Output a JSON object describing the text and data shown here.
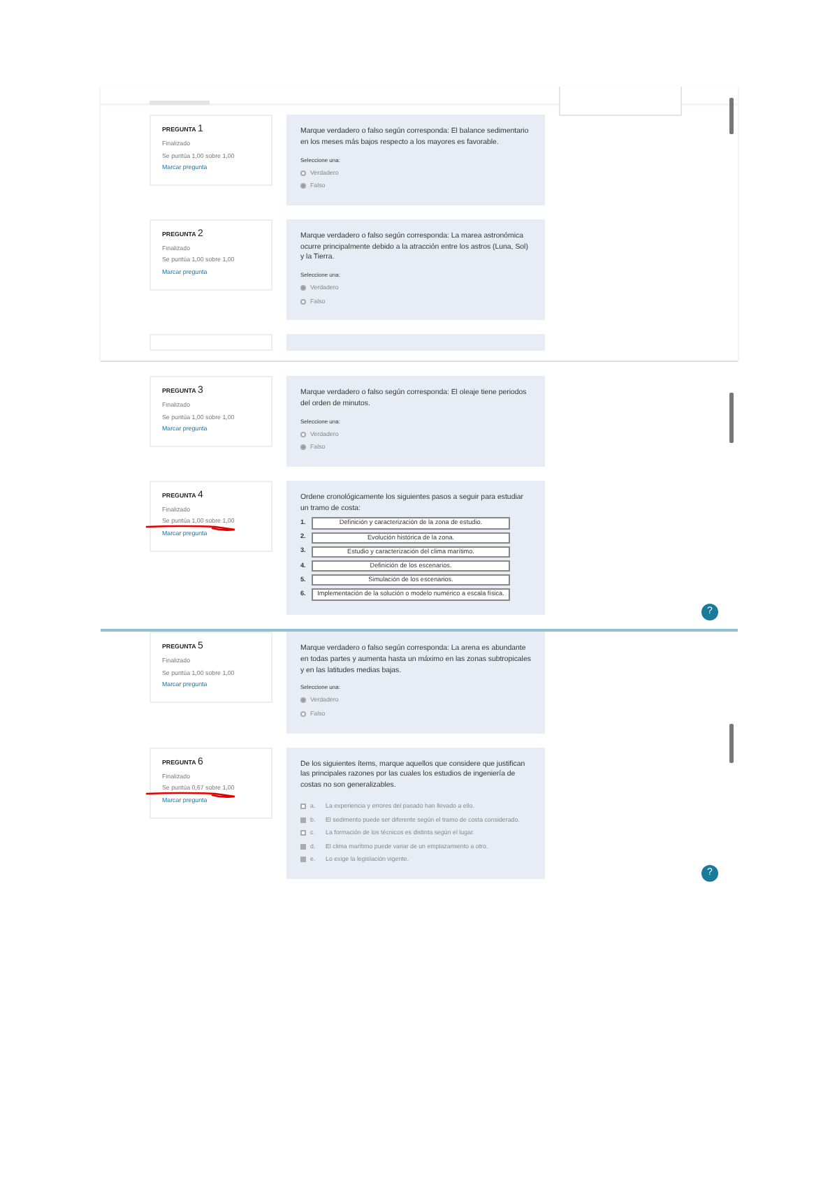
{
  "screenshots": [
    {
      "questions": [
        {
          "kind": "truefalse",
          "label": "PREGUNTA",
          "number": "1",
          "status": "Finalizado",
          "score": "Se puntúa 1,00 sobre 1,00",
          "flag": "Marcar pregunta",
          "text": "Marque verdadero o falso según corresponda: El balance sedimentario en los meses más bajos respecto a los mayores es favorable.",
          "prompt": "Seleccione una:",
          "options": [
            {
              "label": "Verdadero",
              "selected": false
            },
            {
              "label": "Falso",
              "selected": true
            }
          ]
        },
        {
          "kind": "truefalse",
          "label": "PREGUNTA",
          "number": "2",
          "status": "Finalizado",
          "score": "Se puntúa 1,00 sobre 1,00",
          "flag": "Marcar pregunta",
          "text": "Marque verdadero o falso según corresponda: La marea astronómica ocurre principalmente debido a la atracción entre los astros (Luna, Sol) y la Tierra.",
          "prompt": "Seleccione una:",
          "options": [
            {
              "label": "Verdadero",
              "selected": true
            },
            {
              "label": "Falso",
              "selected": false
            }
          ]
        },
        {
          "kind": "partial"
        }
      ]
    },
    {
      "help_button": true,
      "questions": [
        {
          "kind": "truefalse",
          "label": "PREGUNTA",
          "number": "3",
          "status": "Finalizado",
          "score": "Se puntúa 1,00 sobre 1,00",
          "flag": "Marcar pregunta",
          "text": "Marque verdadero o falso según corresponda: El oleaje tiene periodos del orden de minutos.",
          "prompt": "Seleccione una:",
          "options": [
            {
              "label": "Verdadero",
              "selected": false
            },
            {
              "label": "Falso",
              "selected": true
            }
          ]
        },
        {
          "kind": "ordering",
          "label": "PREGUNTA",
          "number": "4",
          "status": "Finalizado",
          "score": "Se puntúa 1,00 sobre 1,00",
          "flag": "Marcar pregunta",
          "text": "Ordene cronológicamente los siguientes pasos a seguir para estudiar un tramo de costa:",
          "items": [
            {
              "index": "1.",
              "label": "Definición y caracterización de la zona de estudio."
            },
            {
              "index": "2.",
              "label": "Evolución histórica de la zona."
            },
            {
              "index": "3.",
              "label": "Estudio y caracterización del clima marítimo."
            },
            {
              "index": "4.",
              "label": "Definición de los escenarios."
            },
            {
              "index": "5.",
              "label": "Simulación de los escenarios."
            },
            {
              "index": "6.",
              "label": "Implementación de la solución o modelo numérico a escala física."
            }
          ],
          "annotated": true
        }
      ]
    },
    {
      "help_button": true,
      "questions": [
        {
          "kind": "truefalse",
          "label": "PREGUNTA",
          "number": "5",
          "status": "Finalizado",
          "score": "Se puntúa 1,00 sobre 1,00",
          "flag": "Marcar pregunta",
          "text": "Marque verdadero o falso según corresponda: La arena es abundante en todas partes y aumenta hasta un máximo en las zonas subtropicales y en las latitudes medias bajas.",
          "prompt": "Seleccione una:",
          "options": [
            {
              "label": "Verdadero",
              "selected": true
            },
            {
              "label": "Falso",
              "selected": false
            }
          ]
        },
        {
          "kind": "multichoice",
          "label": "PREGUNTA",
          "number": "6",
          "status": "Finalizado",
          "score": "Se puntúa 0,67 sobre 1,00",
          "flag": "Marcar pregunta",
          "text": "De los siguientes ítems, marque aquellos que considere que justifican las principales razones por las cuales los estudios de ingeniería de costas no son generalizables.",
          "options": [
            {
              "letter": "a.",
              "label": "La experiencia y errores del pasado han llevado a ello.",
              "selected": false
            },
            {
              "letter": "b.",
              "label": "El sedimento puede ser diferente según el tramo de costa considerado.",
              "selected": true
            },
            {
              "letter": "c.",
              "label": "La formación de los técnicos es distinta según el lugar.",
              "selected": false
            },
            {
              "letter": "d.",
              "label": "El clima marítimo puede variar de un emplazamiento a otro.",
              "selected": true
            },
            {
              "letter": "e.",
              "label": "Lo exige la legislación vigente.",
              "selected": true
            }
          ],
          "annotated": true
        }
      ]
    }
  ],
  "help_label": "?"
}
